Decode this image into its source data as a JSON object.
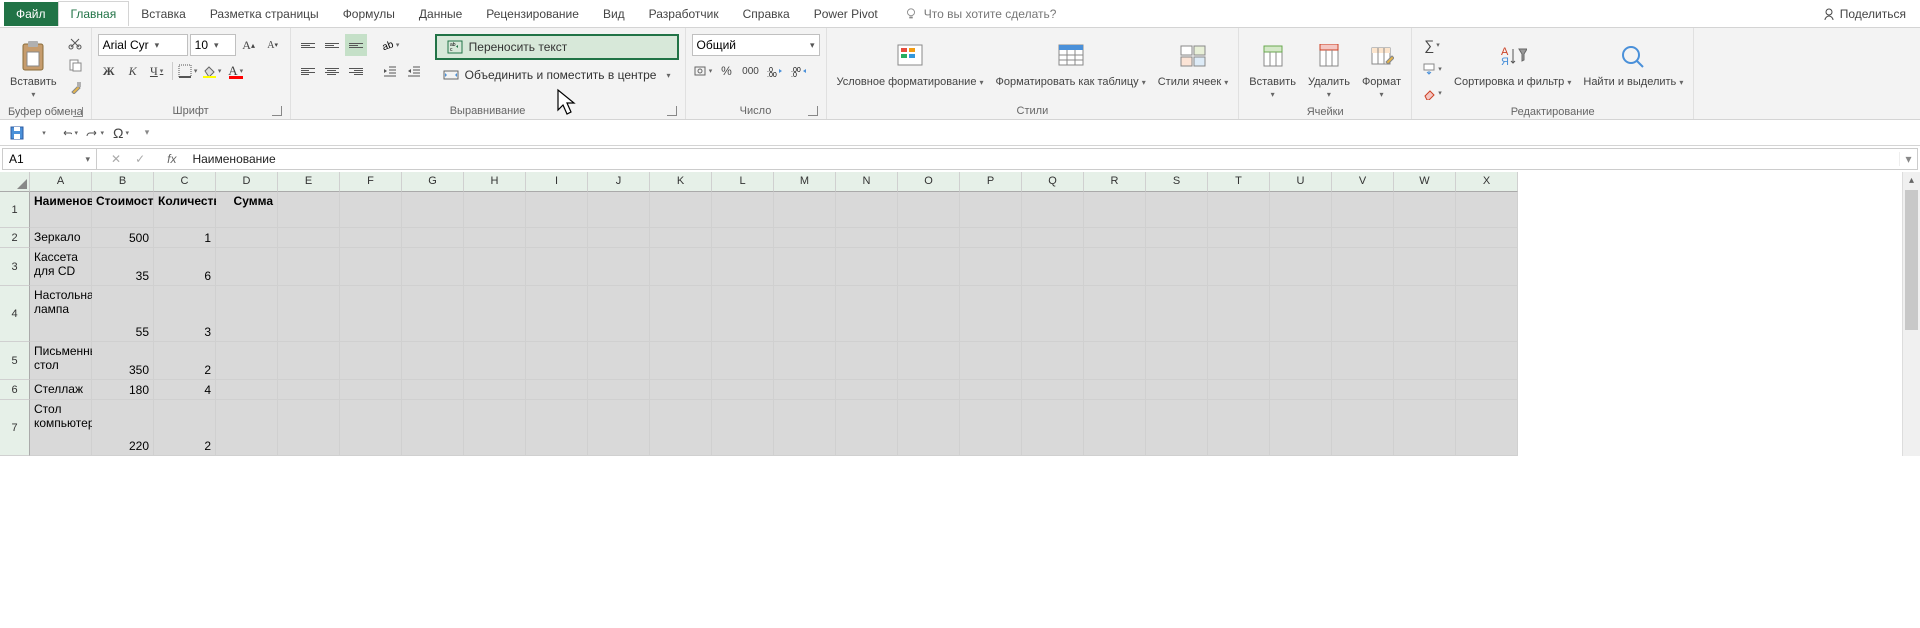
{
  "tabs": {
    "file": "Файл",
    "home": "Главная",
    "insert": "Вставка",
    "layout": "Разметка страницы",
    "formulas": "Формулы",
    "data": "Данные",
    "review": "Рецензирование",
    "view": "Вид",
    "developer": "Разработчик",
    "help": "Справка",
    "powerpivot": "Power Pivot",
    "tellme": "Что вы хотите сделать?",
    "share": "Поделиться"
  },
  "ribbon": {
    "clipboard": {
      "label": "Буфер обмена",
      "paste": "Вставить"
    },
    "font": {
      "label": "Шрифт",
      "name": "Arial Cyr",
      "size": "10",
      "bold": "Ж",
      "italic": "К",
      "underline": "Ч"
    },
    "alignment": {
      "label": "Выравнивание",
      "wrap": "Переносить текст",
      "merge": "Объединить и поместить в центре"
    },
    "number": {
      "label": "Число",
      "format": "Общий",
      "percent": "%",
      "thousands": "000"
    },
    "styles": {
      "label": "Стили",
      "conditional": "Условное форматирование",
      "table": "Форматировать как таблицу",
      "cell": "Стили ячеек"
    },
    "cells": {
      "label": "Ячейки",
      "insert": "Вставить",
      "delete": "Удалить",
      "format": "Формат"
    },
    "editing": {
      "label": "Редактирование",
      "sort": "Сортировка и фильтр",
      "find": "Найти и выделить"
    }
  },
  "formula_bar": {
    "cell_ref": "A1",
    "fx": "fx",
    "content": "Наименование"
  },
  "sheet": {
    "columns": [
      "A",
      "B",
      "C",
      "D",
      "E",
      "F",
      "G",
      "H",
      "I",
      "J",
      "K",
      "L",
      "M",
      "N",
      "O",
      "P",
      "Q",
      "R",
      "S",
      "T",
      "U",
      "V",
      "W",
      "X"
    ],
    "headers": {
      "a": "Наименование",
      "b": "Стоимость",
      "c": "Количество",
      "d": "Сумма"
    },
    "rows": [
      {
        "a": "Зеркало",
        "b": "500",
        "c": "1"
      },
      {
        "a": "Кассета для CD",
        "b": "35",
        "c": "6"
      },
      {
        "a": "Настольная лампа",
        "b": "55",
        "c": "3"
      },
      {
        "a": "Письменный стол",
        "b": "350",
        "c": "2"
      },
      {
        "a": "Стеллаж",
        "b": "180",
        "c": "4"
      },
      {
        "a": "Стол компьютерный",
        "b": "220",
        "c": "2"
      }
    ]
  },
  "chart_data": {
    "type": "table",
    "columns": [
      "Наименование",
      "Стоимость",
      "Количество",
      "Сумма"
    ],
    "rows": [
      [
        "Зеркало",
        500,
        1,
        null
      ],
      [
        "Кассета для CD",
        35,
        6,
        null
      ],
      [
        "Настольная лампа",
        55,
        3,
        null
      ],
      [
        "Письменный стол",
        350,
        2,
        null
      ],
      [
        "Стеллаж",
        180,
        4,
        null
      ],
      [
        "Стол компьютерный",
        220,
        2,
        null
      ]
    ]
  }
}
